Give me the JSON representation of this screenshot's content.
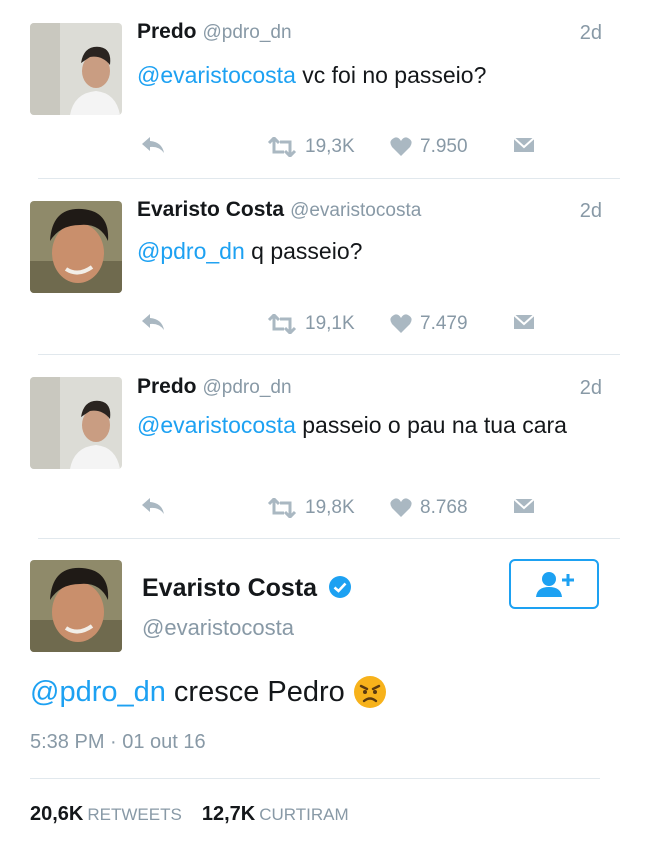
{
  "tweets": [
    {
      "name": "Predo",
      "handle": "@pdro_dn",
      "time": "2d",
      "mention": "@evaristocosta",
      "body": " vc foi no passeio?",
      "retweets": "19,3K",
      "likes": "7.950"
    },
    {
      "name": "Evaristo Costa",
      "handle": "@evaristocosta",
      "time": "2d",
      "mention": "@pdro_dn",
      "body": " q passeio?",
      "retweets": "19,1K",
      "likes": "7.479"
    },
    {
      "name": "Predo",
      "handle": "@pdro_dn",
      "time": "2d",
      "mention": "@evaristocosta",
      "body": " passeio o pau na tua cara",
      "retweets": "19,8K",
      "likes": "8.768"
    }
  ],
  "detail": {
    "name": "Evaristo Costa",
    "handle": "@evaristocosta",
    "mention": "@pdro_dn",
    "body": " cresce Pedro",
    "emoji": "angry-face-emoji",
    "timestamp": "5:38 PM · 01 out 16",
    "retweets_count": "20,6K",
    "retweets_label": "RETWEETS",
    "likes_count": "12,7K",
    "likes_label": "CURTIRAM"
  },
  "colors": {
    "accent": "#1da1f2",
    "muted": "#8899a6",
    "divider": "#e1e8ed"
  }
}
